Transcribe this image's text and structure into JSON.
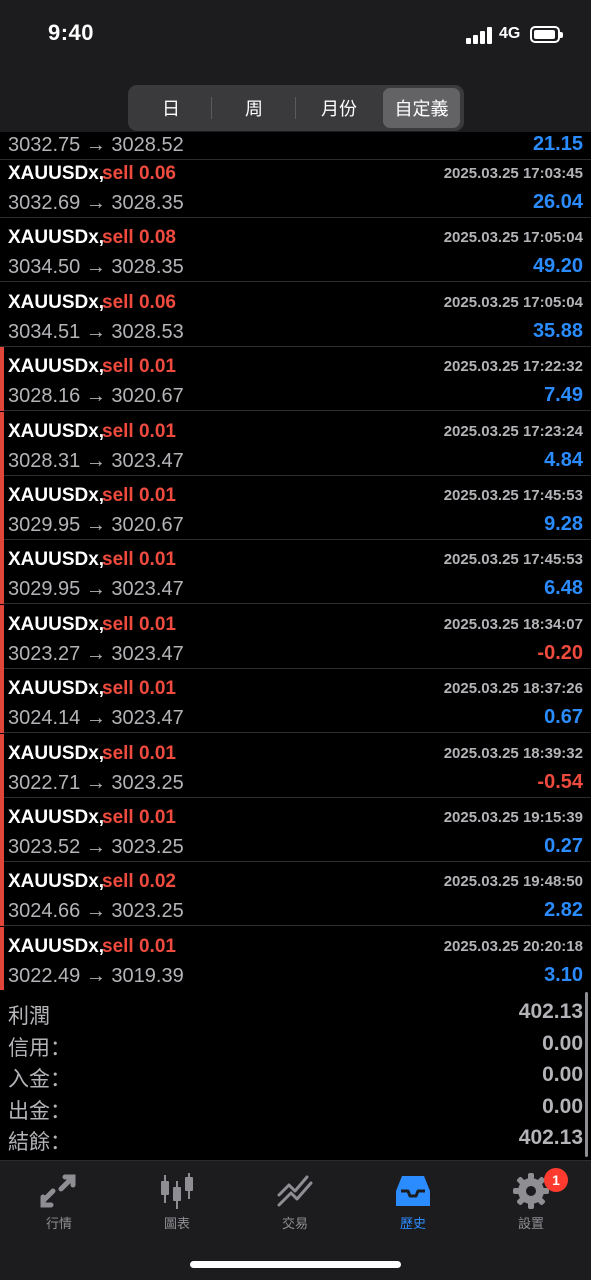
{
  "status": {
    "time": "9:40",
    "network": "4G"
  },
  "periods": [
    "日",
    "周",
    "月份",
    "自定義"
  ],
  "partial_row": {
    "prices": "3032.75 → 3028.52",
    "profit": "21.15"
  },
  "deals": [
    {
      "symbol": "XAUUSDx,",
      "side": "sell 0.06",
      "time": "2025.03.25 17:03:45",
      "prices": "3032.69 → 3028.35",
      "profit": "26.04",
      "accent": false,
      "negative": false
    },
    {
      "symbol": "XAUUSDx,",
      "side": "sell 0.08",
      "time": "2025.03.25 17:05:04",
      "prices": "3034.50 → 3028.35",
      "profit": "49.20",
      "accent": false,
      "negative": false
    },
    {
      "symbol": "XAUUSDx,",
      "side": "sell 0.06",
      "time": "2025.03.25 17:05:04",
      "prices": "3034.51 → 3028.53",
      "profit": "35.88",
      "accent": false,
      "negative": false
    },
    {
      "symbol": "XAUUSDx,",
      "side": "sell 0.01",
      "time": "2025.03.25 17:22:32",
      "prices": "3028.16 → 3020.67",
      "profit": "7.49",
      "accent": true,
      "negative": false
    },
    {
      "symbol": "XAUUSDx,",
      "side": "sell 0.01",
      "time": "2025.03.25 17:23:24",
      "prices": "3028.31 → 3023.47",
      "profit": "4.84",
      "accent": true,
      "negative": false
    },
    {
      "symbol": "XAUUSDx,",
      "side": "sell 0.01",
      "time": "2025.03.25 17:45:53",
      "prices": "3029.95 → 3020.67",
      "profit": "9.28",
      "accent": true,
      "negative": false
    },
    {
      "symbol": "XAUUSDx,",
      "side": "sell 0.01",
      "time": "2025.03.25 17:45:53",
      "prices": "3029.95 → 3023.47",
      "profit": "6.48",
      "accent": true,
      "negative": false
    },
    {
      "symbol": "XAUUSDx,",
      "side": "sell 0.01",
      "time": "2025.03.25 18:34:07",
      "prices": "3023.27 → 3023.47",
      "profit": "-0.20",
      "accent": true,
      "negative": true
    },
    {
      "symbol": "XAUUSDx,",
      "side": "sell 0.01",
      "time": "2025.03.25 18:37:26",
      "prices": "3024.14 → 3023.47",
      "profit": "0.67",
      "accent": true,
      "negative": false
    },
    {
      "symbol": "XAUUSDx,",
      "side": "sell 0.01",
      "time": "2025.03.25 18:39:32",
      "prices": "3022.71 → 3023.25",
      "profit": "-0.54",
      "accent": true,
      "negative": true
    },
    {
      "symbol": "XAUUSDx,",
      "side": "sell 0.01",
      "time": "2025.03.25 19:15:39",
      "prices": "3023.52 → 3023.25",
      "profit": "0.27",
      "accent": true,
      "negative": false
    },
    {
      "symbol": "XAUUSDx,",
      "side": "sell 0.02",
      "time": "2025.03.25 19:48:50",
      "prices": "3024.66 → 3023.25",
      "profit": "2.82",
      "accent": true,
      "negative": false
    },
    {
      "symbol": "XAUUSDx,",
      "side": "sell 0.01",
      "time": "2025.03.25 20:20:18",
      "prices": "3022.49 → 3019.39",
      "profit": "3.10",
      "accent": true,
      "negative": false
    }
  ],
  "summary": [
    {
      "label": "利潤",
      "value": "402.13"
    },
    {
      "label": "信用：",
      "value": "0.00"
    },
    {
      "label": "入金：",
      "value": "0.00"
    },
    {
      "label": "出金：",
      "value": "0.00"
    },
    {
      "label": "結餘：",
      "value": "402.13"
    }
  ],
  "tabs": [
    {
      "label": "行情",
      "icon": "quotes-icon",
      "active": false
    },
    {
      "label": "圖表",
      "icon": "chart-icon",
      "active": false
    },
    {
      "label": "交易",
      "icon": "trade-icon",
      "active": false
    },
    {
      "label": "歷史",
      "icon": "history-icon",
      "active": true
    },
    {
      "label": "設置",
      "icon": "settings-icon",
      "active": false,
      "badge": "1"
    }
  ],
  "colors": {
    "sell": "#ef4a3e",
    "profit_positive": "#2a8cff",
    "profit_negative": "#ef4a3e",
    "accent": "#e0453a",
    "tab_active": "#2a8cff"
  }
}
